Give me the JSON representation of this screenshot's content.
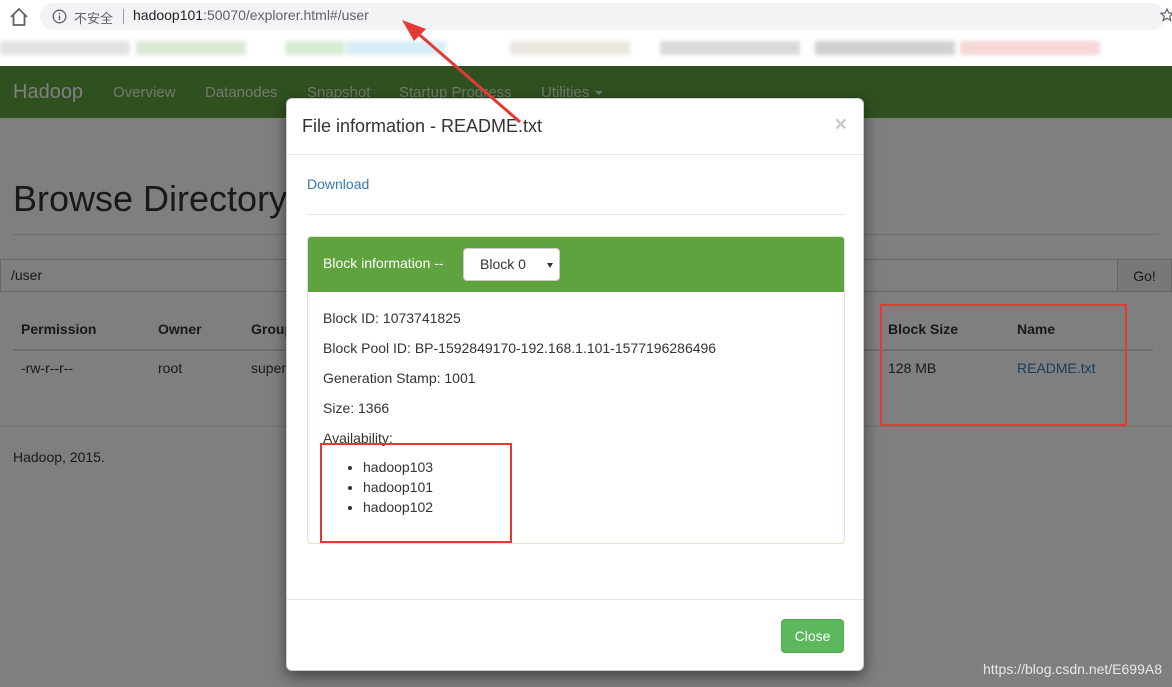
{
  "browser": {
    "insecure_label": "不安全",
    "url_host": "hadoop101",
    "url_rest": ":50070/explorer.html#/user"
  },
  "navbar": {
    "brand": "Hadoop",
    "items": [
      "Overview",
      "Datanodes",
      "Snapshot",
      "Startup Progress",
      "Utilities"
    ]
  },
  "page": {
    "title": "Browse Directory",
    "path_value": "/user",
    "go_label": "Go!",
    "columns": [
      "Permission",
      "Owner",
      "Group",
      "Block Size",
      "Name"
    ],
    "row": {
      "permission": "-rw-r--r--",
      "owner": "root",
      "group": "supergroup",
      "block_size": "128 MB",
      "name": "README.txt"
    },
    "footer": "Hadoop, 2015."
  },
  "modal": {
    "title": "File information - README.txt",
    "close_symbol": "×",
    "download_label": "Download",
    "block_heading": "Block information --",
    "block_select": "Block 0",
    "block_id": "Block ID: 1073741825",
    "block_pool_id": "Block Pool ID: BP-1592849170-192.168.1.101-1577196286496",
    "generation_stamp": "Generation Stamp: 1001",
    "size": "Size: 1366",
    "availability_label": "Availability:",
    "availability": [
      "hadoop103",
      "hadoop101",
      "hadoop102"
    ],
    "close_button": "Close"
  },
  "watermark": "https://blog.csdn.net/E699A8",
  "colors": {
    "navbar_green": "#5fa33e",
    "link_blue": "#337ab7",
    "close_green": "#5cb85c",
    "annotation_red": "#e53935"
  },
  "icons": [
    "home-icon",
    "info-icon",
    "star-icon",
    "close-icon",
    "caret-down-icon"
  ]
}
